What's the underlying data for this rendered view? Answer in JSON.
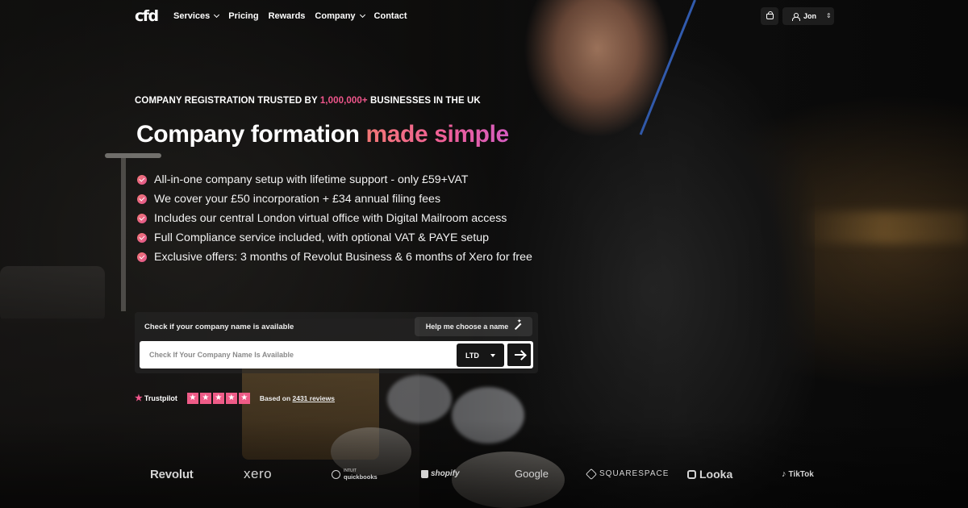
{
  "nav": {
    "logo": "cfd",
    "items": [
      {
        "label": "Services",
        "has_dropdown": true
      },
      {
        "label": "Pricing",
        "has_dropdown": false
      },
      {
        "label": "Rewards",
        "has_dropdown": false
      },
      {
        "label": "Company",
        "has_dropdown": true
      },
      {
        "label": "Contact",
        "has_dropdown": false
      }
    ],
    "basket_icon": "basket-icon",
    "user": {
      "name": "Jon",
      "icon": "user-icon"
    }
  },
  "hero": {
    "eyebrow_before": "COMPANY REGISTRATION TRUSTED BY ",
    "eyebrow_accent": "1,000,000+",
    "eyebrow_after": " BUSINESSES IN THE UK",
    "headline_plain": "Company formation ",
    "headline_accent": "made simple",
    "features": [
      "All-in-one company setup with lifetime support - only £59+VAT",
      "We cover your £50 incorporation + £34 annual filing fees",
      "Includes our central London virtual office with Digital Mailroom access",
      "Full Compliance service included, with optional VAT & PAYE setup",
      "Exclusive offers: 3 months of Revolut Business & 6 months of Xero for free"
    ]
  },
  "search": {
    "title": "Check if your company name is available",
    "help_button": "Help me choose a name",
    "placeholder": "Check If Your Company Name Is Available",
    "value": "",
    "company_type": "LTD"
  },
  "trustpilot": {
    "brand": "Trustpilot",
    "stars": 5,
    "based_on": "Based on ",
    "reviews_link": "2431 reviews"
  },
  "partners": {
    "revolut": "Revolut",
    "xero": "xero",
    "quickbooks_small": "INTUIT",
    "quickbooks": "quickbooks",
    "shopify": "shopify",
    "google": "Google",
    "squarespace": "SQUARESPACE",
    "looka": "Looka",
    "tiktok": "TikTok"
  },
  "colors": {
    "accent_pink": "#f0568c",
    "gradient_start": "#f37876",
    "gradient_end": "#d45cc0",
    "trustpilot_star": "#ee5b87"
  }
}
